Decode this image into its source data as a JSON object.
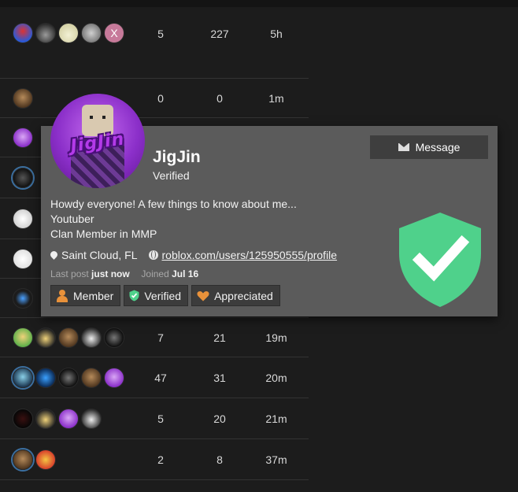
{
  "colors": {
    "background": "#1c1c1c",
    "card": "#5b5b5b",
    "shield": "#4fd18b",
    "heart": "#e8913a",
    "member_icon": "#e8913a"
  },
  "topics": [
    {
      "posters": [
        "avatar-hero",
        "avatar-dark-hat",
        "avatar-top-hat",
        "avatar-grey",
        "avatar-letter-x"
      ],
      "letter": "X",
      "replies": "5",
      "views": "227",
      "activity": "5h"
    },
    {
      "posters": [
        "avatar-brown"
      ],
      "replies": "0",
      "views": "0",
      "activity": "1m"
    },
    {
      "posters": [
        "avatar-purple"
      ],
      "replies": "",
      "views": "",
      "activity": ""
    },
    {
      "posters": [
        "avatar-dark"
      ],
      "replies": "",
      "views": "",
      "activity": ""
    },
    {
      "posters": [
        "avatar-sketch"
      ],
      "replies": "",
      "views": "",
      "activity": ""
    },
    {
      "posters": [
        "avatar-white"
      ],
      "replies": "",
      "views": "",
      "activity": ""
    },
    {
      "posters": [
        "avatar-small"
      ],
      "replies": "",
      "views": "",
      "activity": ""
    },
    {
      "posters": [
        "avatar-green",
        "avatar-black-hair",
        "avatar-brown",
        "avatar-witch",
        "avatar-dark-face"
      ],
      "replies": "7",
      "views": "21",
      "activity": "19m"
    },
    {
      "posters": [
        "avatar-ninja",
        "avatar-blue-splash",
        "avatar-dark-face",
        "avatar-brown",
        "avatar-purple"
      ],
      "replies": "47",
      "views": "31",
      "activity": "20m"
    },
    {
      "posters": [
        "avatar-shadow",
        "avatar-black-hair",
        "avatar-purple",
        "avatar-witch"
      ],
      "replies": "5",
      "views": "20",
      "activity": "21m"
    },
    {
      "posters": [
        "avatar-brown",
        "avatar-fries"
      ],
      "replies": "2",
      "views": "8",
      "activity": "37m"
    }
  ],
  "user_card": {
    "avatar_text": "JigJin",
    "name": "JigJin",
    "title": "Verified",
    "message_label": "Message",
    "bio_lines": [
      "Howdy everyone! A few things to know about me...",
      "Youtuber",
      "Clan Member in MMP"
    ],
    "location": "Saint Cloud, FL",
    "website": "roblox.com/users/125950555/profile",
    "last_post_label": "Last post",
    "last_post_value": "just now",
    "joined_label": "Joined",
    "joined_value": "Jul 16",
    "badges": [
      {
        "label": "Member",
        "icon": "person-icon"
      },
      {
        "label": "Verified",
        "icon": "shield-check-icon"
      },
      {
        "label": "Appreciated",
        "icon": "heart-icon"
      }
    ],
    "featured_badge_icon": "shield-check-icon"
  }
}
